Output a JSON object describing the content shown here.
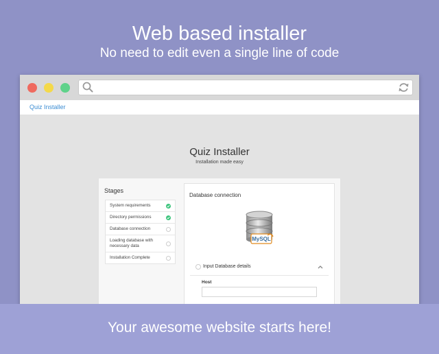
{
  "hero": {
    "title": "Web based installer",
    "subtitle": "No need to edit even a single line of code"
  },
  "browser": {
    "window_controls": [
      "close",
      "minimize",
      "maximize"
    ],
    "colors": {
      "close": "#ef6a5f",
      "minimize": "#f4d94a",
      "maximize": "#5fd28a"
    },
    "address_bar": {
      "value": "",
      "icons": [
        "search-icon",
        "refresh-icon"
      ]
    }
  },
  "navbar": {
    "brand": "Quiz Installer"
  },
  "page": {
    "title": "Quiz Installer",
    "subtitle": "Installation made easy"
  },
  "stages": {
    "title": "Stages",
    "items": [
      {
        "label": "System requirements",
        "status": "done"
      },
      {
        "label": "Directory permissions",
        "status": "done"
      },
      {
        "label": "Database connection",
        "status": "pending"
      },
      {
        "label": "Loading database with necessary data",
        "status": "pending"
      },
      {
        "label": "Installation Complete",
        "status": "pending"
      }
    ]
  },
  "database": {
    "title": "Database connection",
    "logo": {
      "icon": "mysql-database-icon",
      "text": "MySQL"
    },
    "section_title": "Input Database details",
    "host_label": "Host",
    "host_value": ""
  },
  "footer": {
    "text": "Your awesome website starts here!"
  },
  "colors": {
    "background": "#8f92c6",
    "footer_band": "#9ea1d6",
    "link": "#3c8dd3",
    "done_check": "#3cc47c"
  }
}
